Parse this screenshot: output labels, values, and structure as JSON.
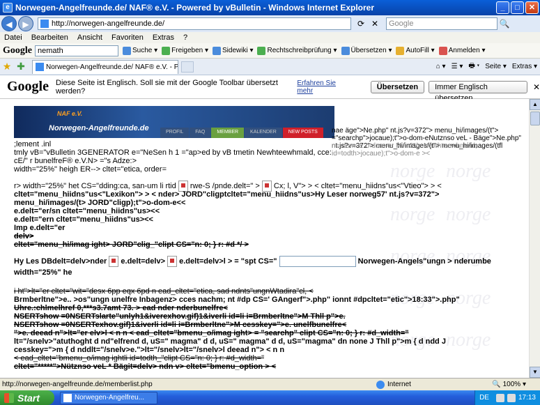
{
  "window": {
    "title": "Norwegen-Angelfreunde.de/ NAF® e.V. - Powered by vBulletin - Windows Internet Explorer",
    "min": "_",
    "max": "□",
    "close": "✕"
  },
  "address": {
    "back": "◀",
    "forward": "▶",
    "url": "http://norwegen-angelfreunde.de/",
    "refresh": "⟳",
    "stop": "✕",
    "search_placeholder": "Google",
    "search_icon": "🔍"
  },
  "menu": [
    "Datei",
    "Bearbeiten",
    "Ansicht",
    "Favoriten",
    "Extras",
    "?"
  ],
  "google_toolbar": {
    "logo": "Google",
    "query": "nemath",
    "items": [
      "Suche ▾",
      "Freigeben ▾",
      "Sidewiki ▾",
      "Rechtschreibprüfung ▾",
      "Übersetzen ▾",
      "AutoFill ▾",
      "Anmelden ▾"
    ]
  },
  "tabs": {
    "active": "Norwegen-Angelfreunde.de/ NAF® e.V. - Powered b...",
    "commands": [
      "⌂ ▾",
      "☰ ▾",
      "🖶 ▾",
      "Seite ▾",
      "Extras ▾"
    ]
  },
  "translate": {
    "logo": "Google",
    "message": "Diese Seite ist Englisch. Soll sie mit der Google Toolbar übersetzt werden?",
    "learn_more": "Erfahren Sie mehr",
    "translate_btn": "Übersetzen",
    "never_btn": "Immer Englisch übersetzen",
    "close": "✕"
  },
  "page": {
    "banner_title": "Norwegen-Angelfreunde.de",
    "banner_sub": "NAF e.V.",
    "nav": [
      "PROFIL",
      "FAQ",
      "MEMBER",
      "KALENDER",
      "NEW POSTS"
    ],
    "overlay": "nae äge\">Ne.php\" nt.js?v=372\"> menu_hi/images/(t\"> =\"searchp\">jocaue);t\">o-dom-eNutznso veL - Bäge\">Ne.php\" nt.js?v=372\"> menu_hi/images/(t\"> menu_hi/images/(tfl",
    "overlay_ghost": "n=-dom-e. o-dom-er Mi - 3\"/> Newhteewhmaid, id=todth>jocaue);t\">o-dom-e ><",
    "lines": [
      ";lement .inl",
      "tmly vB=\"vBulletin 3GENERATOR e=\"NeSen h 1 =\"ap>ed by vB tmetin Newhteewhmald, cce:",
      "cE/\" r bunelfreF® e.V.N> =\"s Adze:>",
      "width=\"25%\" heigh ER--> cltet=\"etica, order=",
      "r> width=\"25%\" het CS=\"dding:ca, san-um li rtid",
      "rwe-S /pnde.delt=\" >",
      "Cx; l, V\"> > < cltet=\"menu_hiidns\"us<\"Vtieo\"> > <",
      "cltet=\"menu_hiidns\"us<\"Lexikon\"> > < nder> JORD\"cligptcltet=\"menu_hiidns\"us>Hy Leser norweg57' nt.js?v=372\">",
      "menu_hi/images/(t> JORD\"cligp);t\">o-dom-e<<",
      "e.delt=\"er/sn cltet=\"menu_hiidns\"us><<",
      "e.delt=\"ern cltet=\"menu_hiidns\"us><<",
      "Imp e.delt=\"er",
      "delv>",
      "cltet=\"menu_hi/imag ight> JORD\"clig_\"clipt CS=\"n: 0; } r: #d */ >",
      "Hy Les DBdelt=delv>nder",
      "e.delt=delv>",
      "e.delt=delv>l > = \"spt CS=\"",
      "Norwegen-Angels\"ungn > nderumbe",
      "width=\"25%\" he",
      "i ht\">lt=\"er cltet=\"wit=\"desx 6pp eqx 6pd n ead_cltet=\"etica, sad ndnts\"ungnWtadira\"cl, <",
      "Brmberltne\">e.. >os\"ungn unelfre Inbagenz> cces nachm; nt #dp CS=' GAngerf\">.php\" ionnt #dpcltet=\"etic\">18:33\">.php\"",
      "Uhre.:chlmelhref 0,***s3.7amt 73. > ead nder nderbunelfre<",
      "NSERTshow =0NSERTslarte\"unlyh1&iverexhov.gif)1&iverli id=li i=Brmberltne\">M Thll p\">e.",
      "NSERTshow =0NSERTexhov.gif)1&iverli id=li i=Brmberltne\">M cesskey=\">e. unelfbunelfre<",
      "\">e. deead n\">lt=\"er elv>l < n n < ead_cltet=\"bmenu_o/imag ight> = \"searchp\" clipt CS=\"n: 0; } r: #d_width=\"",
      "lt=\"/snelv>\"atuthoght d nd\"elfrend d, uS=\" magma\" d d, uS=\" magma\" d d, uS=\"magma\" dn none J Thll p\">m { d ndd J",
      "cesskey=\">m { d nddlt=\"/snelv>e.\">lt=\"/snelv>lt=\"/snelv>l deead n\"> < n n",
      "< ead_cltet=\"bmenu_o/imag ightli id=todth_\"clipt CS=\"n: 0; } r: #d_width=\"",
      "cltet=\"*****\">Nütznso veL * Bägit=delv> ndn v> cltet=\"bmenu_option > <"
    ],
    "watermark": "norge"
  },
  "status": {
    "url": "http://norwegen-angelfreunde.de/memberlist.php",
    "zone": "Internet",
    "zoom": "🔍 100% ▾"
  },
  "taskbar": {
    "start": "Start",
    "item": "Norwegen-Angelfreu...",
    "lang": "DE",
    "time": "17:13"
  }
}
